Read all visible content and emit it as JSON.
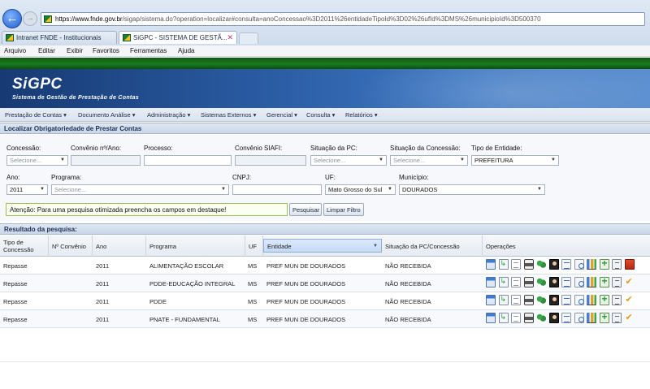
{
  "browser": {
    "address_domain": "https://www.fnde.gov.br",
    "address_rest": "/sigap/sistema.do?operation=localizar#consulta=anoConcessao%3D2011%26entidadeTipoId%3D02%26ufId%3DMS%26municipioId%3D500370",
    "tabs": [
      {
        "label": "Intranet FNDE - Institucionais"
      },
      {
        "label": "SiGPC - SISTEMA DE GESTÃ..."
      }
    ],
    "menu": [
      "Arquivo",
      "Editar",
      "Exibir",
      "Favoritos",
      "Ferramentas",
      "Ajuda"
    ]
  },
  "app": {
    "logo": "SiGPC",
    "subtitle": "Sistema de Gestão de Prestação de Contas",
    "menu": [
      "Prestação de Contas ▾",
      "Documento Análise ▾",
      "Administração ▾",
      "Sistemas Externos ▾",
      "Gerencial ▾",
      "Consulta ▾",
      "Relatórios ▾"
    ]
  },
  "search": {
    "title": "Localizar Obrigatoriedade de Prestar Contas",
    "labels": {
      "concessao": "Concessão:",
      "convenio_ano": "Convênio nº/Ano:",
      "processo": "Processo:",
      "convenio_siafi": "Convênio SIAFI:",
      "situacao_pc": "Situação da PC:",
      "situacao_concessao": "Situação da Concessão:",
      "tipo_entidade": "Tipo de Entidade:",
      "ano": "Ano:",
      "programa": "Programa:",
      "cnpj": "CNPJ:",
      "uf": "UF:",
      "municipio": "Município:"
    },
    "values": {
      "concessao": "Selecione...",
      "situacao_pc": "Selecione...",
      "situacao_concessao": "Selecione...",
      "tipo_entidade": "PREFEITURA",
      "ano": "2011",
      "programa": "Selecione...",
      "uf": "Mato Grosso do Sul",
      "municipio": "DOURADOS"
    },
    "attention": "Atenção: Para uma pesquisa otimizada preencha os campos em destaque!",
    "search_button": "Pesquisar",
    "clear_button": "Limpar Filtro"
  },
  "results": {
    "title": "Resultado da pesquisa:",
    "headers": {
      "tipo_line1": "Tipo de",
      "tipo_line2": "Concessão",
      "convenio": "Nº Convênio",
      "ano": "Ano",
      "programa": "Programa",
      "uf": "UF",
      "entidade": "Entidade",
      "situacao": "Situação da PC/Concessão",
      "operacoes": "Operações"
    },
    "rows": [
      {
        "tipo": "Repasse",
        "convenio": "",
        "ano": "2011",
        "programa": "ALIMENTAÇÃO ESCOLAR",
        "uf": "MS",
        "entidade": "PREF MUN DE DOURADOS",
        "situacao": "NÃO RECEBIDA"
      },
      {
        "tipo": "Repasse",
        "convenio": "",
        "ano": "2011",
        "programa": "PDDE-EDUCAÇÃO INTEGRAL",
        "uf": "MS",
        "entidade": "PREF MUN DE DOURADOS",
        "situacao": "NÃO RECEBIDA"
      },
      {
        "tipo": "Repasse",
        "convenio": "",
        "ano": "2011",
        "programa": "PDDE",
        "uf": "MS",
        "entidade": "PREF MUN DE DOURADOS",
        "situacao": "NÃO RECEBIDA"
      },
      {
        "tipo": "Repasse",
        "convenio": "",
        "ano": "2011",
        "programa": "PNATE - FUNDAMENTAL",
        "uf": "MS",
        "entidade": "PREF MUN DE DOURADOS",
        "situacao": "NÃO RECEBIDA"
      }
    ],
    "row_operation_icons": [
      [
        "table-icon",
        "import-icon",
        "doc-icon",
        "print-icon",
        "users-icon",
        "person-icon",
        "list-icon",
        "search-doc-icon",
        "chart-icon",
        "add-icon",
        "clipboard-icon",
        "red-icon"
      ],
      [
        "table-icon",
        "import-icon",
        "doc-icon",
        "print-icon",
        "users-icon",
        "person-icon",
        "list-icon",
        "search-doc-icon",
        "chart-icon",
        "add-icon",
        "clipboard-icon",
        "check-icon"
      ],
      [
        "table-icon",
        "import-icon",
        "doc-icon",
        "print-icon",
        "users-icon",
        "person-icon",
        "list-icon",
        "search-doc-icon",
        "chart-icon",
        "add-icon",
        "clipboard-icon",
        "check-icon"
      ],
      [
        "table-icon",
        "import-icon",
        "doc-icon",
        "print-icon",
        "users-icon",
        "person-icon",
        "list-icon",
        "search-doc-icon",
        "chart-icon",
        "add-icon",
        "clipboard-icon",
        "check-icon"
      ]
    ]
  }
}
